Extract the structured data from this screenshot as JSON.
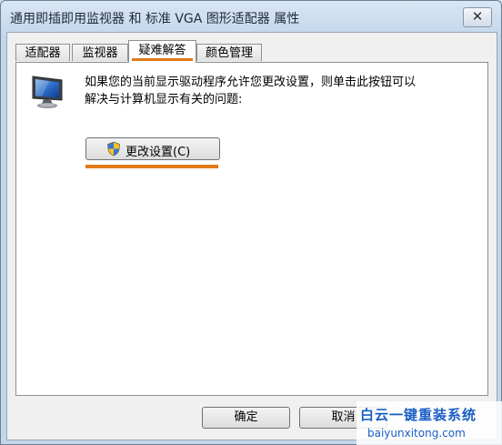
{
  "window": {
    "title": "通用即插即用监视器 和 标准 VGA 图形适配器 属性",
    "close_glyph": "✕"
  },
  "tabs": [
    {
      "label": "适配器"
    },
    {
      "label": "监视器"
    },
    {
      "label": "疑难解答",
      "selected": true
    },
    {
      "label": "颜色管理"
    }
  ],
  "troubleshoot": {
    "description_line1": "如果您的当前显示驱动程序允许您更改设置，则单击此按钮可以",
    "description_line2": "解决与计算机显示有关的问题:",
    "change_button_label": "更改设置(C)",
    "icon": "monitor-icon"
  },
  "footer": {
    "ok_label": "确定",
    "cancel_label": "取消"
  },
  "watermark": {
    "title": "白云一键重装系统",
    "url": "baiyunxitong.com"
  },
  "colors": {
    "highlight": "#e07a19",
    "watermark": "#1a5fc4"
  }
}
